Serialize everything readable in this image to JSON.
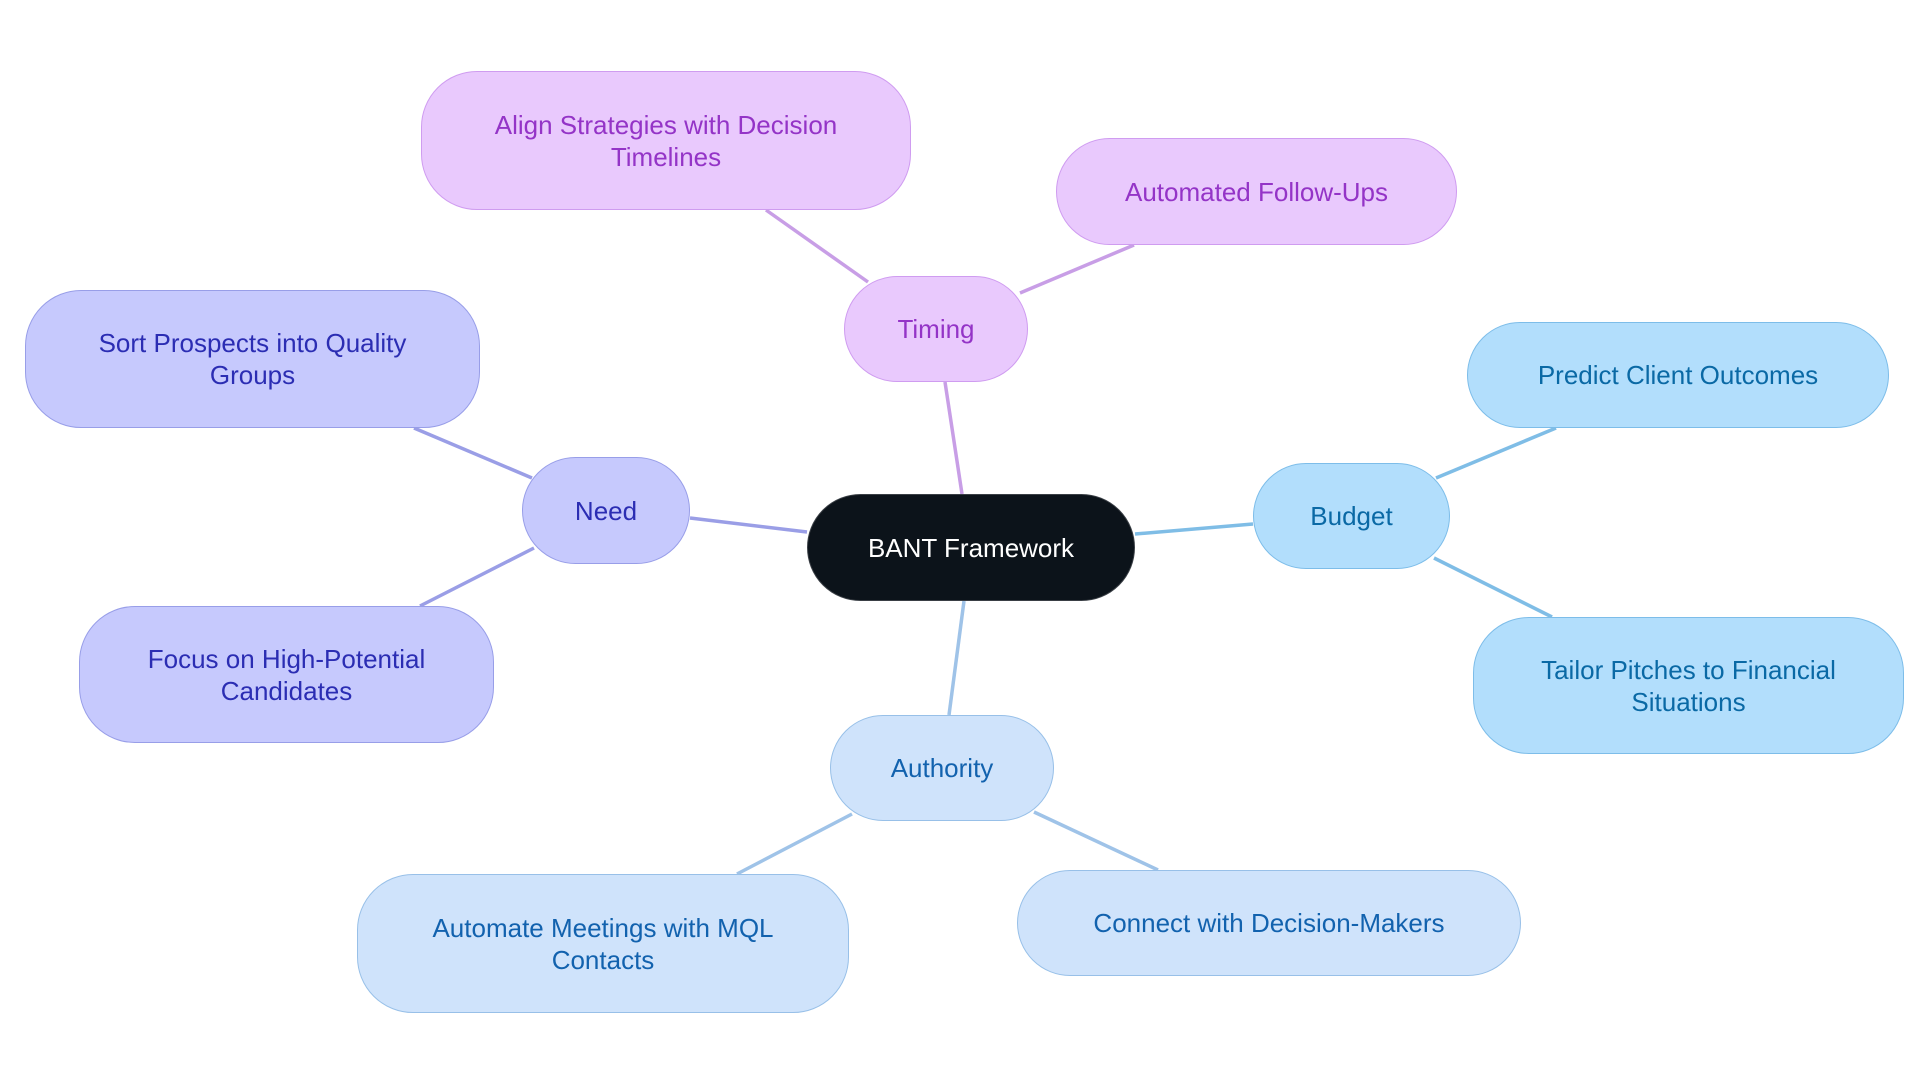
{
  "title": "BANT Framework",
  "colors": {
    "root": "#0c131a",
    "timing": "#e9c9fd",
    "need": "#c6c9fd",
    "budget": "#b2defc",
    "authority": "#cfe3fb",
    "timing_edge": "#c89ee6",
    "need_edge": "#9a9ee6",
    "budget_edge": "#7fbde6",
    "authority_edge": "#9fc3e8"
  },
  "nodes": {
    "root": {
      "label": "BANT Framework"
    },
    "timing": {
      "label": "Timing"
    },
    "timing_c1": {
      "label": "Align Strategies with Decision Timelines"
    },
    "timing_c2": {
      "label": "Automated Follow-Ups"
    },
    "need": {
      "label": "Need"
    },
    "need_c1": {
      "label": "Sort Prospects into Quality Groups"
    },
    "need_c2": {
      "label": "Focus on High-Potential Candidates"
    },
    "budget": {
      "label": "Budget"
    },
    "budget_c1": {
      "label": "Predict Client Outcomes"
    },
    "budget_c2": {
      "label": "Tailor Pitches to Financial Situations"
    },
    "authority": {
      "label": "Authority"
    },
    "authority_c1": {
      "label": "Automate Meetings with MQL Contacts"
    },
    "authority_c2": {
      "label": "Connect with Decision-Makers"
    }
  },
  "edges": [
    {
      "from": "root",
      "to": "timing",
      "branch": "timing"
    },
    {
      "from": "timing",
      "to": "timing_c1",
      "branch": "timing"
    },
    {
      "from": "timing",
      "to": "timing_c2",
      "branch": "timing"
    },
    {
      "from": "root",
      "to": "need",
      "branch": "need"
    },
    {
      "from": "need",
      "to": "need_c1",
      "branch": "need"
    },
    {
      "from": "need",
      "to": "need_c2",
      "branch": "need"
    },
    {
      "from": "root",
      "to": "budget",
      "branch": "budget"
    },
    {
      "from": "budget",
      "to": "budget_c1",
      "branch": "budget"
    },
    {
      "from": "budget",
      "to": "budget_c2",
      "branch": "budget"
    },
    {
      "from": "root",
      "to": "authority",
      "branch": "authority"
    },
    {
      "from": "authority",
      "to": "authority_c1",
      "branch": "authority"
    },
    {
      "from": "authority",
      "to": "authority_c2",
      "branch": "authority"
    }
  ]
}
